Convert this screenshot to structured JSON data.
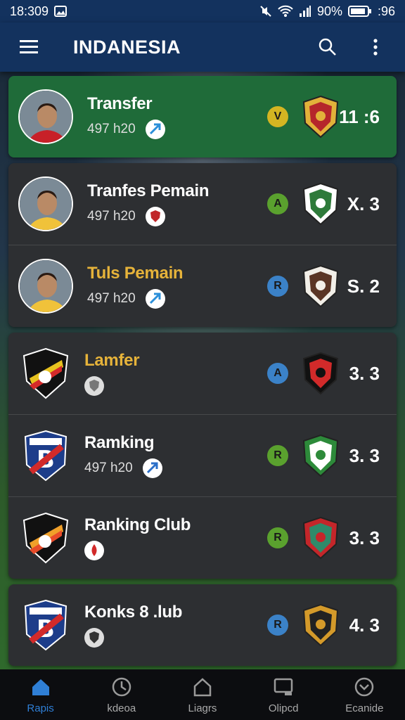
{
  "status": {
    "time": "18:309",
    "battery": "90%",
    "right_text": ":96"
  },
  "appbar": {
    "title": "INDANESIA"
  },
  "groups": [
    {
      "highlight": true,
      "rows": [
        {
          "name": "Transfer",
          "name_color": "white",
          "sub_text": "497 h20",
          "sub_icon": "send-icon",
          "sub_icon_color": "#2b8fd9",
          "letter": "V",
          "letter_color": "#d4b522",
          "club_colors": [
            "#e2b23a",
            "#b5262b"
          ],
          "score": "11 :6"
        }
      ]
    },
    {
      "highlight": false,
      "rows": [
        {
          "name": "Tranfes Pemain",
          "name_color": "white",
          "sub_text": "497 h20",
          "sub_icon": "shield-icon",
          "sub_icon_color": "#c0262a",
          "letter": "A",
          "letter_color": "#5aa12e",
          "club_colors": [
            "#ffffff",
            "#2e7a3a"
          ],
          "score": "X. 3"
        },
        {
          "name": "Tuls Pemain",
          "name_color": "gold",
          "sub_text": "497 h20",
          "sub_icon": "send-icon",
          "sub_icon_color": "#2b8fd9",
          "letter": "R",
          "letter_color": "#3b82c8",
          "club_colors": [
            "#f2efe8",
            "#5a3525"
          ],
          "score": "S. 2"
        }
      ]
    },
    {
      "highlight": false,
      "rows": [
        {
          "name": "Lamfer",
          "name_color": "gold",
          "sub_text": "",
          "sub_icon": "shield-icon",
          "sub_icon_color": "#9a9a9a",
          "letter": "A",
          "letter_color": "#3b82c8",
          "club_colors": [
            "#111111",
            "#d22a2a"
          ],
          "score": "3. 3",
          "logo": "bird"
        },
        {
          "name": "Ramking",
          "name_color": "white",
          "sub_text": "497 h20",
          "sub_icon": "send-icon",
          "sub_icon_color": "#2b6fc8",
          "letter": "R",
          "letter_color": "#5aa12e",
          "club_colors": [
            "#2d8a3a",
            "#ffffff"
          ],
          "score": "3. 3",
          "logo": "B"
        },
        {
          "name": "Ranking Club",
          "name_color": "white",
          "sub_text": "",
          "sub_icon": "drop-icon",
          "sub_icon_color": "#d22a2a",
          "letter": "R",
          "letter_color": "#5aa12e",
          "club_colors": [
            "#c4262a",
            "#2e8a6a"
          ],
          "score": "3. 3",
          "logo": "bird2"
        }
      ]
    },
    {
      "highlight": false,
      "rows": [
        {
          "name": "Konks 8 .lub",
          "name_color": "white",
          "sub_text": "",
          "sub_icon": "shield-icon",
          "sub_icon_color": "#ffffff",
          "letter": "R",
          "letter_color": "#3b82c8",
          "club_colors": [
            "#d49a2a",
            "#222222"
          ],
          "score": "4. 3",
          "logo": "B2"
        }
      ]
    }
  ],
  "bottom_nav": [
    {
      "label": "Rapis",
      "icon": "home-icon",
      "active": true
    },
    {
      "label": "kdeoa",
      "icon": "clock-icon",
      "active": false
    },
    {
      "label": "Liagrs",
      "icon": "house-outline-icon",
      "active": false
    },
    {
      "label": "Olipcd",
      "icon": "screen-icon",
      "active": false
    },
    {
      "label": "Ecanide",
      "icon": "chevron-circle-icon",
      "active": false
    }
  ]
}
